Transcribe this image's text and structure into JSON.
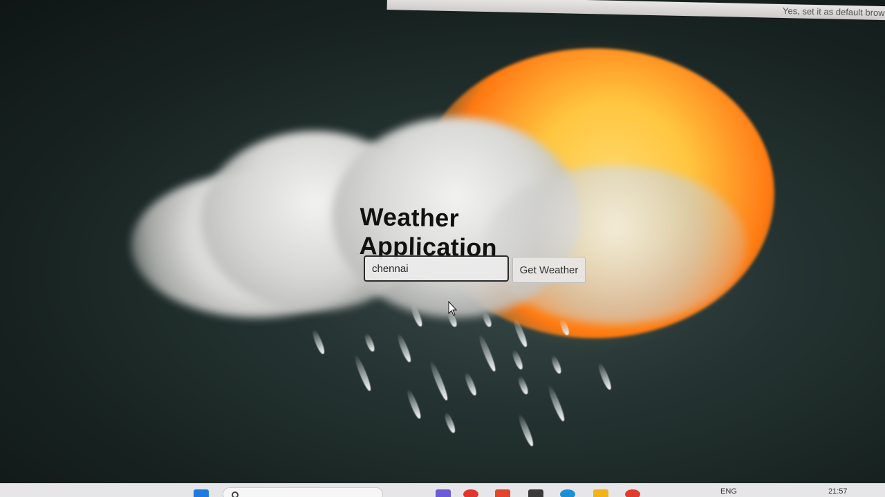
{
  "browser": {
    "infobar_text": "Yes, set it as default brow"
  },
  "app": {
    "title": "Weather Application",
    "search": {
      "value": "chennai",
      "placeholder": ""
    },
    "button_label": "Get Weather"
  },
  "taskbar": {
    "lang": "ENG",
    "time": "21:57"
  },
  "colors": {
    "title": "#111111",
    "sun": "#ff8a1e",
    "background": "#1b2826"
  }
}
